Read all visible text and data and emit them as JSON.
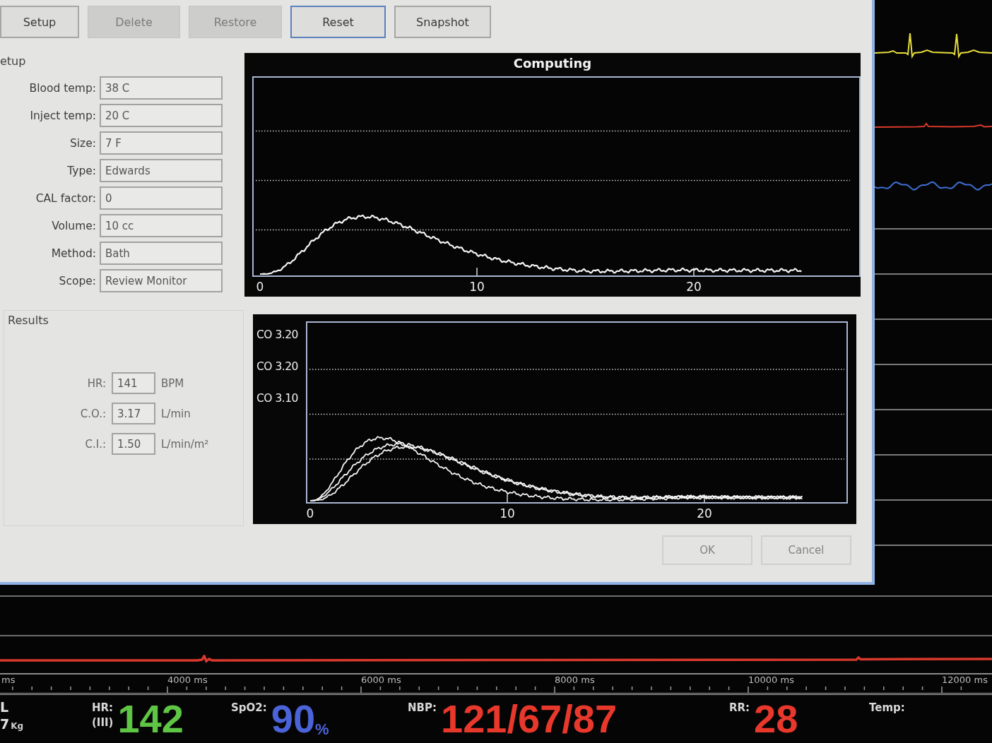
{
  "toolbar": {
    "buttons": [
      {
        "label": "Setup",
        "disabled": false,
        "focused": false
      },
      {
        "label": "Delete",
        "disabled": true,
        "focused": false
      },
      {
        "label": "Restore",
        "disabled": true,
        "focused": false
      },
      {
        "label": "Reset",
        "disabled": false,
        "focused": true
      },
      {
        "label": "Snapshot",
        "disabled": false,
        "focused": false
      }
    ]
  },
  "setup": {
    "title": "etup",
    "fields": [
      {
        "label": "Blood temp:",
        "value": "38 C"
      },
      {
        "label": "Inject temp:",
        "value": "20 C"
      },
      {
        "label": "Size:",
        "value": "7 F"
      },
      {
        "label": "Type:",
        "value": "Edwards"
      },
      {
        "label": "CAL factor:",
        "value": "0"
      },
      {
        "label": "Volume:",
        "value": "10 cc"
      },
      {
        "label": "Method:",
        "value": "Bath"
      },
      {
        "label": "Scope:",
        "value": "Review Monitor"
      }
    ]
  },
  "results": {
    "title": "Results",
    "rows": [
      {
        "label": "HR:",
        "value": "141",
        "unit": "BPM"
      },
      {
        "label": "C.O.:",
        "value": "3.17",
        "unit": "L/min"
      },
      {
        "label": "C.I.:",
        "value": "1.50",
        "unit": "L/min/m²"
      }
    ]
  },
  "curve_chart": {
    "title": "Computing",
    "axis_labels": [
      "0",
      "10",
      "20"
    ]
  },
  "average_chart": {
    "curve_labels": [
      "CO 3.20",
      "CO 3.20",
      "CO 3.10"
    ],
    "axis_labels": [
      "0",
      "10",
      "20"
    ]
  },
  "dialog_buttons": [
    {
      "label": "OK",
      "disabled": true
    },
    {
      "label": "Cancel",
      "disabled": true
    }
  ],
  "time_axis": {
    "labels": [
      "ms",
      "4000 ms",
      "6000 ms",
      "8000 ms",
      "10000 ms",
      "12000 ms"
    ]
  },
  "vitals": {
    "patient": {
      "line_1": "L",
      "weight": "7",
      "weight_unit": "Kg"
    },
    "parameters": [
      {
        "label": "HR:",
        "sublabel": "(III)",
        "value": "142",
        "color": "#5fc545"
      },
      {
        "label": "SpO2:",
        "value": "90",
        "unit": "%",
        "color": "#4b63d8"
      },
      {
        "label": "NBP:",
        "value": "121/67/87",
        "color": "#e8382c"
      },
      {
        "label": "RR:",
        "value": "28",
        "color": "#e8382c"
      },
      {
        "label": "Temp:"
      }
    ]
  }
}
